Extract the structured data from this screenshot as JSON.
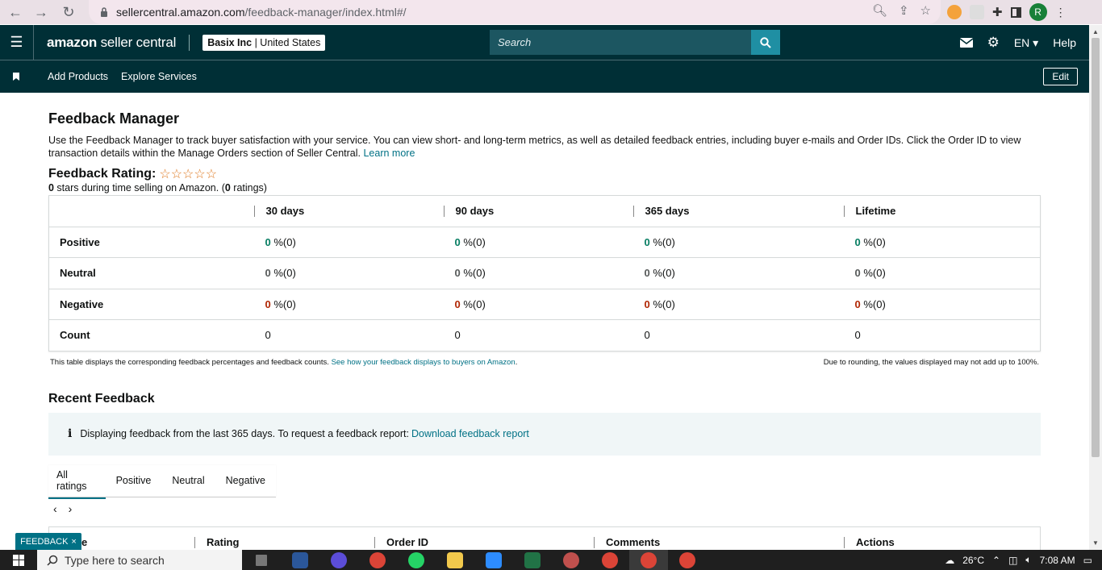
{
  "browser": {
    "url_host": "sellercentral.amazon.com",
    "url_path": "/feedback-manager/index.html#/",
    "profile_initial": "R"
  },
  "header": {
    "logo_brand": "amazon",
    "logo_rest": " seller central",
    "account_name": "Basix Inc",
    "account_region": " | United States",
    "search_placeholder": "Search",
    "language": "EN",
    "help": "Help"
  },
  "subnav": {
    "items": [
      "Add Products",
      "Explore Services"
    ],
    "edit": "Edit"
  },
  "page": {
    "title": "Feedback Manager",
    "intro": "Use the Feedback Manager to track buyer satisfaction with your service. You can view short- and long-term metrics, as well as detailed feedback entries, including buyer e-mails and Order IDs. Click the Order ID to view transaction details within the Manage Orders section of Seller Central. ",
    "learn_more": "Learn more",
    "rating_title": "Feedback Rating:",
    "stars": "☆☆☆☆☆",
    "rating_stars_count": "0",
    "rating_sub_mid": " stars during time selling on Amazon. (",
    "rating_count": "0",
    "rating_sub_end": " ratings)"
  },
  "metrics_table": {
    "columns": [
      "30 days",
      "90 days",
      "365 days",
      "Lifetime"
    ],
    "rows": [
      {
        "label": "Positive",
        "values": [
          "0",
          "0",
          "0",
          "0"
        ],
        "suffix": " %(0)"
      },
      {
        "label": "Neutral",
        "values": [
          "0",
          "0",
          "0",
          "0"
        ],
        "suffix": " %(0)"
      },
      {
        "label": "Negative",
        "values": [
          "0",
          "0",
          "0",
          "0"
        ],
        "suffix": " %(0)"
      },
      {
        "label": "Count",
        "values": [
          "0",
          "0",
          "0",
          "0"
        ]
      }
    ],
    "note_left": "This table displays the corresponding feedback percentages and feedback counts. ",
    "note_link": "See how your feedback displays to buyers on Amazon",
    "note_left_end": ".",
    "note_right": "Due to rounding, the values displayed may not add up to 100%."
  },
  "recent": {
    "title": "Recent Feedback",
    "info_text": "Displaying feedback from the last 365 days. To request a feedback report: ",
    "info_link": "Download feedback report",
    "tabs": [
      "All ratings",
      "Positive",
      "Neutral",
      "Negative"
    ],
    "pager_prev": "‹",
    "pager_next": "›",
    "table_columns": [
      "e",
      "Rating",
      "Order ID",
      "Comments",
      "Actions"
    ]
  },
  "feedback_widget": {
    "label": "FEEDBACK",
    "close": "×"
  },
  "taskbar": {
    "search_placeholder": "Type here to search",
    "temperature": "26°C",
    "time": "7:08 AM"
  },
  "colors": {
    "header_bg": "#002f36",
    "positive": "#067d62",
    "negative": "#b12704",
    "link": "#007185"
  }
}
